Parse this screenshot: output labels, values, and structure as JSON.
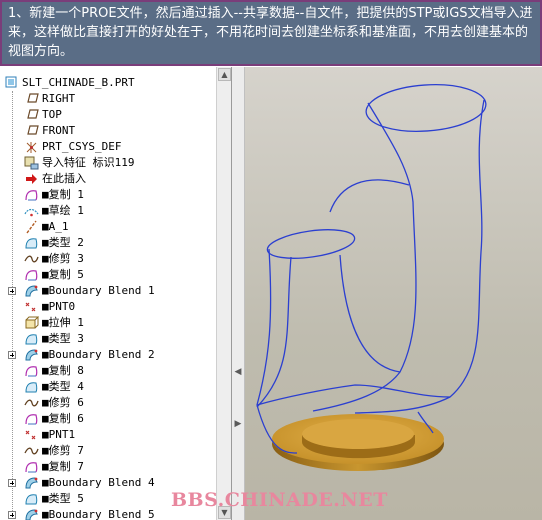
{
  "banner": {
    "text": "1、新建一个PROE文件，然后通过插入--共享数据--自文件，把提供的STP或IGS文档导入进来，这样做比直接打开的好处在于，不用花时间去创建坐标系和基准面，不用去创建基本的视图方向。"
  },
  "tree": {
    "items": [
      {
        "label": "SLT_CHINADE_B.PRT",
        "icon": "part-icon",
        "indent": 0,
        "expand": false
      },
      {
        "label": "RIGHT",
        "icon": "datum-plane-icon",
        "indent": 1,
        "expand": false
      },
      {
        "label": "TOP",
        "icon": "datum-plane-icon",
        "indent": 1,
        "expand": false
      },
      {
        "label": "FRONT",
        "icon": "datum-plane-icon",
        "indent": 1,
        "expand": false
      },
      {
        "label": "PRT_CSYS_DEF",
        "icon": "coordinate-system-icon",
        "indent": 1,
        "expand": false
      },
      {
        "label": "导入特征 标识119",
        "icon": "import-feature-icon",
        "indent": 1,
        "expand": false
      },
      {
        "label": "在此插入",
        "icon": "insert-here-arrow-icon",
        "indent": 1,
        "expand": false
      },
      {
        "label": "■复制 1",
        "icon": "copy-surface-icon",
        "indent": 1,
        "expand": false
      },
      {
        "label": "■草绘 1",
        "icon": "sketch-icon",
        "indent": 1,
        "expand": false
      },
      {
        "label": "■A_1",
        "icon": "datum-axis-icon",
        "indent": 1,
        "expand": false
      },
      {
        "label": "■类型 2",
        "icon": "type-surface-icon",
        "indent": 1,
        "expand": false
      },
      {
        "label": "■修剪 3",
        "icon": "trim-curve-icon",
        "indent": 1,
        "expand": false
      },
      {
        "label": "■复制 5",
        "icon": "copy-surface-icon",
        "indent": 1,
        "expand": false
      },
      {
        "label": "■Boundary Blend 1",
        "icon": "boundary-blend-icon",
        "indent": 1,
        "expand": true
      },
      {
        "label": "■PNT0",
        "icon": "datum-point-icon",
        "indent": 1,
        "expand": false
      },
      {
        "label": "■拉伸 1",
        "icon": "extrude-icon",
        "indent": 1,
        "expand": false
      },
      {
        "label": "■类型 3",
        "icon": "type-surface-icon",
        "indent": 1,
        "expand": false
      },
      {
        "label": "■Boundary Blend 2",
        "icon": "boundary-blend-icon",
        "indent": 1,
        "expand": true
      },
      {
        "label": "■复制 8",
        "icon": "copy-surface-icon",
        "indent": 1,
        "expand": false
      },
      {
        "label": "■类型 4",
        "icon": "type-surface-icon",
        "indent": 1,
        "expand": false
      },
      {
        "label": "■修剪 6",
        "icon": "trim-curve-icon",
        "indent": 1,
        "expand": false
      },
      {
        "label": "■复制 6",
        "icon": "copy-surface-icon",
        "indent": 1,
        "expand": false
      },
      {
        "label": "■PNT1",
        "icon": "datum-point-icon",
        "indent": 1,
        "expand": false
      },
      {
        "label": "■修剪 7",
        "icon": "trim-curve-icon",
        "indent": 1,
        "expand": false
      },
      {
        "label": "■复制 7",
        "icon": "copy-surface-icon",
        "indent": 1,
        "expand": false
      },
      {
        "label": "■Boundary Blend 4",
        "icon": "boundary-blend-icon",
        "indent": 1,
        "expand": true
      },
      {
        "label": "■类型 5",
        "icon": "type-surface-icon",
        "indent": 1,
        "expand": false
      },
      {
        "label": "■Boundary Blend 5",
        "icon": "boundary-blend-icon",
        "indent": 1,
        "expand": true
      }
    ]
  },
  "watermark": "BBS.CHINADE.NET",
  "colors": {
    "banner_bg": "#5a6d86",
    "banner_border": "#7a3d7a",
    "wireframe": "#2b3fd0",
    "base_gold": "#c99630",
    "watermark": "#e8879e"
  }
}
